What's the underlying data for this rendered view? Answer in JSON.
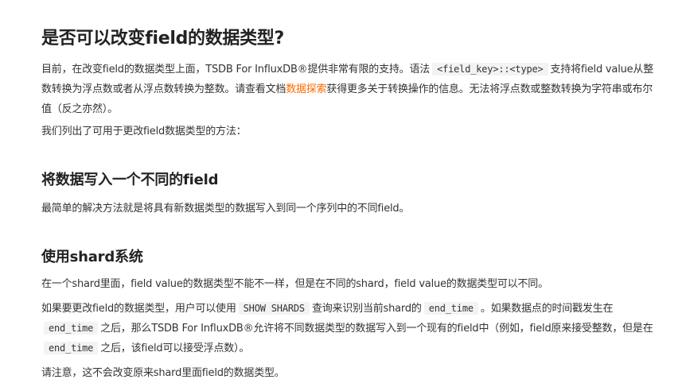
{
  "heading_main": "是否可以改变field的数据类型?",
  "intro": {
    "part1": "目前，在改变field的数据类型上面，TSDB For InfluxDB®提供非常有限的支持。语法",
    "code1": "<field_key>::<type>",
    "part2": "支持将field value从整数转换为浮点数或者从浮点数转换为整数。请查看文档",
    "link": "数据探索",
    "part3": "获得更多关于转换操作的信息。无法将浮点数或整数转换为字符串或布尔值（反之亦然）。"
  },
  "methods_intro": "我们列出了可用于更改field数据类型的方法：",
  "section1": {
    "heading": "将数据写入一个不同的field",
    "text": "最简单的解决方法就是将具有新数据类型的数据写入到同一个序列中的不同field。"
  },
  "section2": {
    "heading": "使用shard系统",
    "p1": "在一个shard里面，field value的数据类型不能不一样，但是在不同的shard，field value的数据类型可以不同。",
    "p2": {
      "t1": "如果要更改field的数据类型，用户可以使用",
      "c1": "SHOW SHARDS",
      "t2": "查询来识别当前shard的",
      "c2": "end_time",
      "t3": "。如果数据点的时间戳发生在",
      "c3": "end_time",
      "t4": "之后，那么TSDB For InfluxDB®允许将不同数据类型的数据写入到一个现有的field中（例如，field原来接受整数，但是在",
      "c4": "end_time",
      "t5": "之后，该field可以接受浮点数）。"
    },
    "p3": "请注意，这不会改变原来shard里面field的数据类型。"
  }
}
